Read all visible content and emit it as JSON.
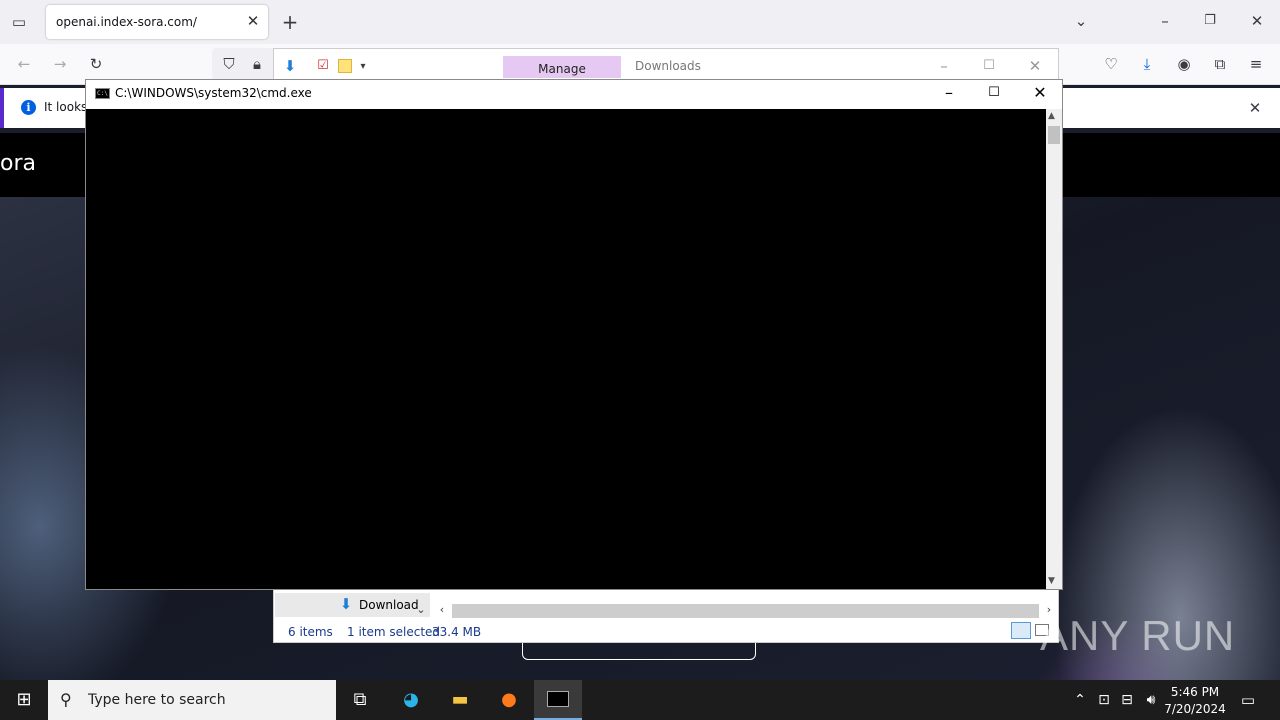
{
  "browser": {
    "tab_title": "openai.index-sora.com/",
    "notification_text": "It looks",
    "site_logo": "ora"
  },
  "downloads_window": {
    "manage_label": "Manage",
    "title": "Downloads",
    "download_button": "Download",
    "status_items": "6 items",
    "status_selected": "1 item selected",
    "status_size": "33.4 MB"
  },
  "cmd_window": {
    "title": "C:\\WINDOWS\\system32\\cmd.exe"
  },
  "taskbar": {
    "search_placeholder": "Type here to search",
    "time": "5:46 PM",
    "date": "7/20/2024"
  },
  "watermark": "ANY RUN"
}
